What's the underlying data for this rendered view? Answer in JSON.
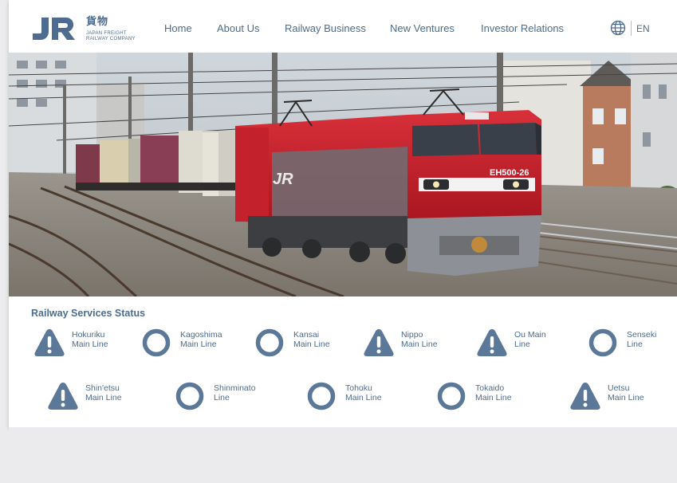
{
  "brand": {
    "logo_text": "JR",
    "kanji": "貨物",
    "line1": "JAPAN FREIGHT",
    "line2": "RAILWAY COMPANY"
  },
  "nav": {
    "items": [
      {
        "label": "Home"
      },
      {
        "label": "About Us"
      },
      {
        "label": "Railway Business"
      },
      {
        "label": "New Ventures"
      },
      {
        "label": "Investor Relations"
      }
    ],
    "language": "EN"
  },
  "hero": {
    "locomotive_number": "EH500-26"
  },
  "status": {
    "title": "Railway Services Status",
    "services": [
      {
        "line1": "Hokuriku",
        "line2": "Main Line",
        "state": "warning",
        "icon": "warning-icon"
      },
      {
        "line1": "Kagoshima",
        "line2": "Main Line",
        "state": "normal",
        "icon": "normal-ring-icon"
      },
      {
        "line1": "Kansai",
        "line2": "Main Line",
        "state": "normal",
        "icon": "normal-ring-icon"
      },
      {
        "line1": "Nippo",
        "line2": "Main Line",
        "state": "warning",
        "icon": "warning-icon"
      },
      {
        "line1": "Ou Main",
        "line2": "Line",
        "state": "warning",
        "icon": "warning-icon"
      },
      {
        "line1": "Senseki",
        "line2": "Line",
        "state": "normal",
        "icon": "normal-ring-icon"
      },
      {
        "line1": "Shin'etsu",
        "line2": "Main Line",
        "state": "warning",
        "icon": "warning-icon"
      },
      {
        "line1": "Shinminato",
        "line2": "Line",
        "state": "normal",
        "icon": "normal-ring-icon"
      },
      {
        "line1": "Tohoku",
        "line2": "Main Line",
        "state": "normal",
        "icon": "normal-ring-icon"
      },
      {
        "line1": "Tokaido",
        "line2": "Main Line",
        "state": "normal",
        "icon": "normal-ring-icon"
      },
      {
        "line1": "Uetsu",
        "line2": "Main Line",
        "state": "warning",
        "icon": "warning-icon"
      }
    ]
  },
  "colors": {
    "brand_blue": "#4e6c8d",
    "icon_blue": "#5b7898",
    "locomotive_red": "#c8202b"
  }
}
